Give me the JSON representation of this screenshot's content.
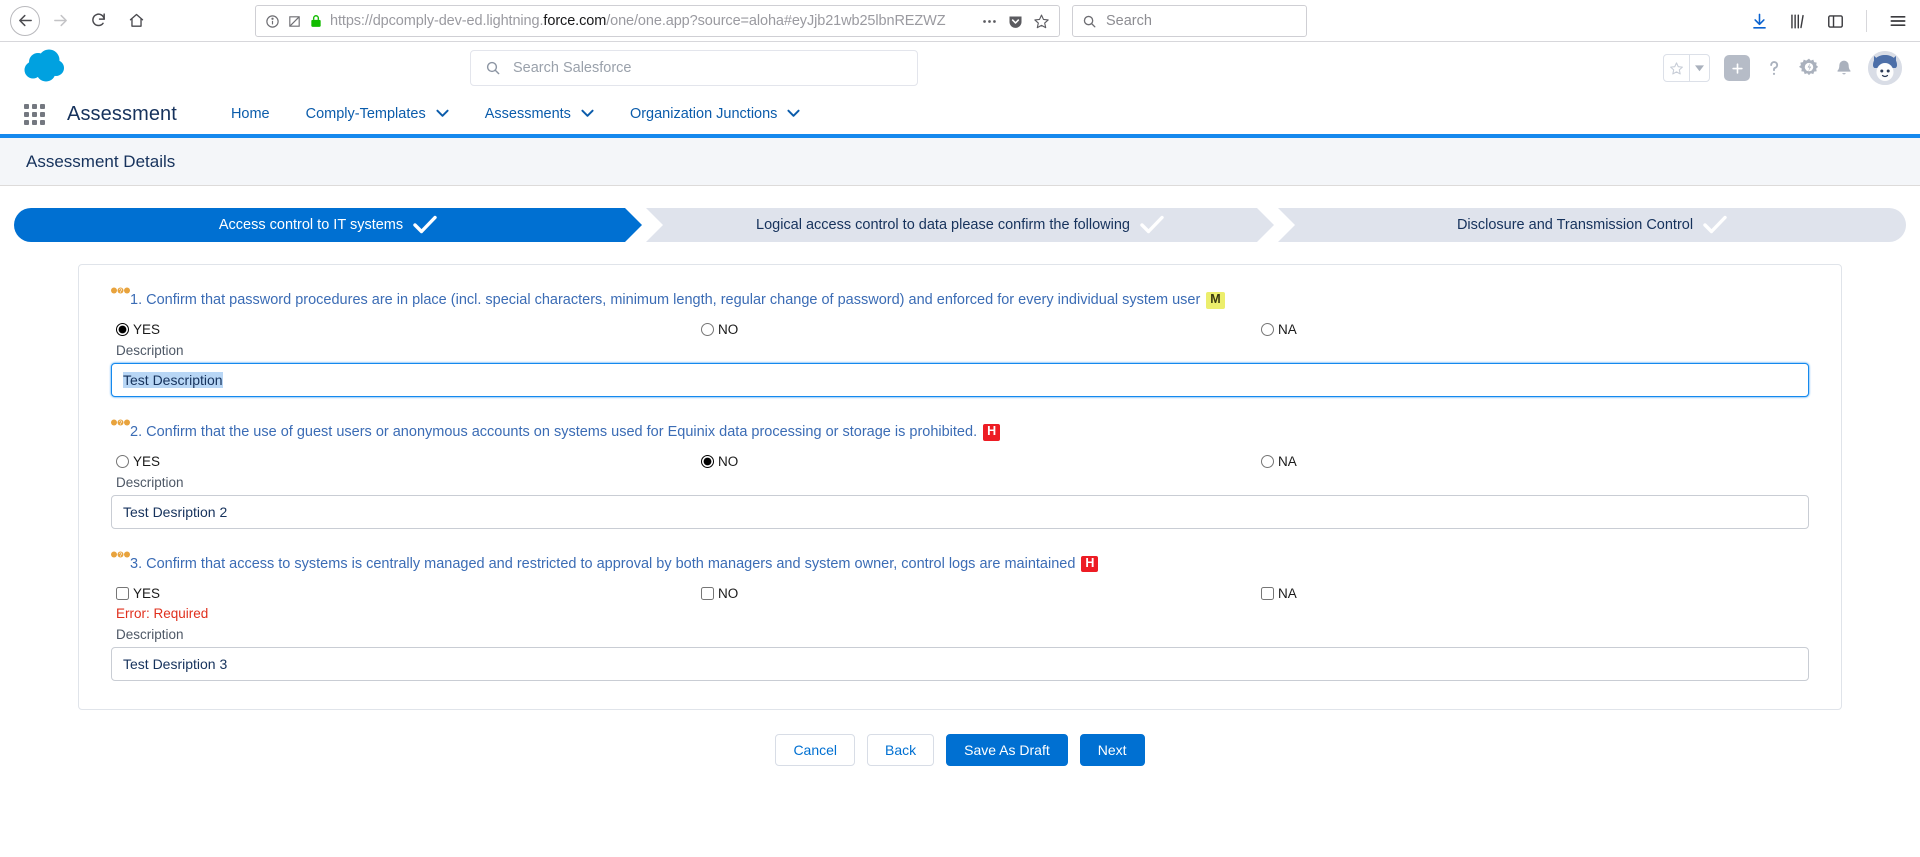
{
  "browser": {
    "back_icon": "arrow-left-icon",
    "forward_icon": "arrow-right-icon",
    "reload_icon": "reload-icon",
    "home_icon": "home-icon",
    "url_prefix": "https://dpcomply-dev-ed.lightning.",
    "url_host_strong": "force.com",
    "url_suffix": "/one/one.app?source=aloha#eyJjb21wb25lbnREZWZ",
    "identity_icon": "info-circle-icon",
    "tracking_icon": "shield-crossed-icon",
    "lock_icon": "padlock-icon",
    "page_actions_icon": "ellipsis-icon",
    "pocket_icon": "pocket-icon",
    "bookmark_icon": "star-outline-icon",
    "search_placeholder": "Search",
    "search_icon": "search-icon",
    "downloads_icon": "download-icon",
    "library_icon": "library-icon",
    "sidebar_icon": "sidebar-icon",
    "menu_icon": "hamburger-menu-icon"
  },
  "sf_header": {
    "logo_icon": "salesforce-cloud-logo",
    "search_placeholder": "Search Salesforce",
    "search_icon": "search-icon",
    "favorites_icon": "star-outline-icon",
    "favorites_dropdown_icon": "chevron-down-icon",
    "add_icon": "plus-icon",
    "help_icon": "question-mark-icon",
    "setup_icon": "gear-icon",
    "notifications_icon": "bell-icon",
    "avatar_icon": "astro-avatar"
  },
  "app_nav": {
    "waffle_icon": "app-launcher-waffle-icon",
    "app_name": "Assessment",
    "items": [
      {
        "label": "Home",
        "has_chevron": false
      },
      {
        "label": "Comply-Templates",
        "has_chevron": true
      },
      {
        "label": "Assessments",
        "has_chevron": true
      },
      {
        "label": "Organization Junctions",
        "has_chevron": true
      }
    ],
    "chevron_icon": "chevron-down-icon"
  },
  "page_header": {
    "title": "Assessment Details"
  },
  "path": {
    "check_icon": "check-mark-icon",
    "steps": [
      {
        "label": "Access control to IT systems",
        "active": true
      },
      {
        "label": "Logical access control to data please confirm the following",
        "active": false
      },
      {
        "label": "Disclosure and Transmission Control",
        "active": false
      }
    ]
  },
  "form": {
    "help_icon": "help-info-icon",
    "description_label": "Description",
    "questions": [
      {
        "number": "1.",
        "text": "Confirm that password procedures are in place (incl. special characters, minimum length, regular change of password) and enforced for every individual system user",
        "badge": "M",
        "badge_type": "m",
        "control": "radio",
        "options": [
          {
            "label": "YES",
            "checked": true
          },
          {
            "label": "NO",
            "checked": false
          },
          {
            "label": "NA",
            "checked": false
          }
        ],
        "description_value": "Test Description",
        "focused": true,
        "error": ""
      },
      {
        "number": "2.",
        "text": "Confirm that the use of guest users or anonymous accounts on systems used for Equinix data processing or storage is prohibited.",
        "badge": "H",
        "badge_type": "h",
        "control": "radio",
        "options": [
          {
            "label": "YES",
            "checked": false
          },
          {
            "label": "NO",
            "checked": true
          },
          {
            "label": "NA",
            "checked": false
          }
        ],
        "description_value": "Test Desription 2",
        "focused": false,
        "error": ""
      },
      {
        "number": "3.",
        "text": "Confirm that access to systems is centrally managed and restricted to approval by both managers and system owner, control logs are maintained",
        "badge": "H",
        "badge_type": "h",
        "control": "checkbox",
        "options": [
          {
            "label": "YES",
            "checked": false
          },
          {
            "label": "NO",
            "checked": false
          },
          {
            "label": "NA",
            "checked": false
          }
        ],
        "description_value": "Test Desription 3",
        "focused": false,
        "error": "Error: Required"
      }
    ]
  },
  "footer": {
    "cancel_label": "Cancel",
    "back_label": "Back",
    "save_draft_label": "Save As Draft",
    "next_label": "Next"
  },
  "colors": {
    "brand_blue": "#0070d2",
    "nav_underline": "#1589ee",
    "badge_medium": "#ecee6c",
    "badge_high": "#ed1c24",
    "error_red": "#e0301e",
    "path_inactive": "#dfe3ec"
  }
}
